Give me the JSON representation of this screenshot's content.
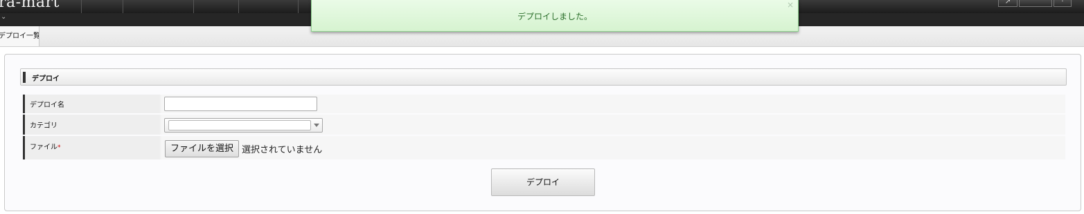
{
  "header": {
    "logo_text": "ra-mart",
    "sub_chevron": "⌄",
    "right_icon_1": "↗",
    "right_icon_3": "·"
  },
  "tabs": [
    {
      "label": "デプロイ一覧"
    }
  ],
  "toast": {
    "message": "デプロイしました。",
    "close_label": "×"
  },
  "section": {
    "title": "デプロイ"
  },
  "form": {
    "deploy_name_label": "デプロイ名",
    "deploy_name_value": "",
    "category_label": "カテゴリ",
    "category_value": "",
    "file_label": "ファイル",
    "file_required_mark": "*",
    "file_button_label": "ファイルを選択",
    "file_status": "選択されていません"
  },
  "actions": {
    "deploy_button_label": "デプロイ"
  },
  "colors": {
    "toast_background": "#d6f3d0",
    "toast_text": "#2a6e2a",
    "required_mark": "#cc0000",
    "header_background": "#1c1c1c"
  }
}
